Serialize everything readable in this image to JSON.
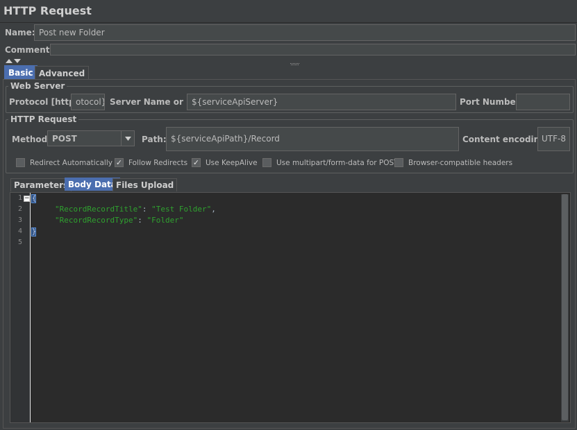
{
  "panel": {
    "title": "HTTP Request"
  },
  "name_field": {
    "label": "Name:",
    "value": "Post new Folder"
  },
  "comments_field": {
    "label": "Comments:",
    "value": ""
  },
  "tabs": [
    {
      "label": "Basic",
      "active": true
    },
    {
      "label": "Advanced",
      "active": false
    }
  ],
  "web_server": {
    "title": "Web Server",
    "protocol_label": "Protocol [http]:",
    "protocol_value": "otocol}",
    "server_label": "Server Name or IP:",
    "server_value": "${serviceApiServer}",
    "port_label": "Port Number:",
    "port_value": ""
  },
  "http_request": {
    "title": "HTTP Request",
    "method_label": "Method:",
    "method_value": "POST",
    "path_label": "Path:",
    "path_value": "${serviceApiPath}/Record",
    "encoding_label": "Content encoding:",
    "encoding_value": "UTF-8",
    "options": [
      {
        "label": "Redirect Automatically",
        "checked": false
      },
      {
        "label": "Follow Redirects",
        "checked": true
      },
      {
        "label": "Use KeepAlive",
        "checked": true
      },
      {
        "label": "Use multipart/form-data for POST",
        "checked": false
      },
      {
        "label": "Browser-compatible headers",
        "checked": false
      }
    ]
  },
  "subtabs": [
    {
      "label": "Parameters",
      "active": false
    },
    {
      "label": "Body Data",
      "active": true
    },
    {
      "label": "Files Upload",
      "active": false
    }
  ],
  "editor": {
    "line_numbers": [
      "1",
      "2",
      "3",
      "4",
      "5"
    ],
    "open_brace": "{",
    "close_brace": "}",
    "line2_key": "\"RecordRecordTitle\"",
    "line2_sep": ": ",
    "line2_value": "\"Test Folder\"",
    "line2_end": ",",
    "line3_key": "\"RecordRecordType\"",
    "line3_sep": ": ",
    "line3_value": "\"Folder\""
  },
  "colors": {
    "background": "#3c3f41",
    "editor_bg": "#2b2b2b",
    "active_tab": "#4b6eaf",
    "string": "#2fa12f"
  }
}
